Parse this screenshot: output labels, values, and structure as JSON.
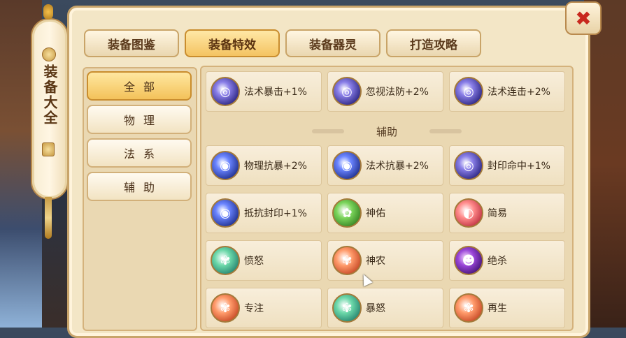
{
  "scroll": {
    "title": "装备大全"
  },
  "close": {
    "glyph": "✖"
  },
  "tabs": [
    {
      "label": "装备图鉴",
      "active": false
    },
    {
      "label": "装备特效",
      "active": true
    },
    {
      "label": "装备器灵",
      "active": false
    },
    {
      "label": "打造攻略",
      "active": false
    }
  ],
  "categories": [
    {
      "label": "全部",
      "active": true
    },
    {
      "label": "物理",
      "active": false
    },
    {
      "label": "法系",
      "active": false
    },
    {
      "label": "辅助",
      "active": false
    }
  ],
  "top_row": [
    {
      "label": "法术暴击+1%",
      "icon": "spell-crit-icon",
      "color": "violet"
    },
    {
      "label": "忽视法防+2%",
      "icon": "ignore-magic-def-icon",
      "color": "violet"
    },
    {
      "label": "法术连击+2%",
      "icon": "spell-combo-icon",
      "color": "violet"
    }
  ],
  "section": {
    "title": "辅助"
  },
  "grid": [
    {
      "label": "物理抗暴+2%",
      "icon": "physical-crit-resist-icon",
      "color": "blue"
    },
    {
      "label": "法术抗暴+2%",
      "icon": "spell-crit-resist-icon",
      "color": "blue"
    },
    {
      "label": "封印命中+1%",
      "icon": "seal-hit-icon",
      "color": "violet"
    },
    {
      "label": "抵抗封印+1%",
      "icon": "seal-resist-icon",
      "color": "blue"
    },
    {
      "label": "神佑",
      "icon": "divine-blessing-icon",
      "color": "green"
    },
    {
      "label": "简易",
      "icon": "simple-icon",
      "color": "red"
    },
    {
      "label": "愤怒",
      "icon": "anger-icon",
      "color": "teal"
    },
    {
      "label": "神农",
      "icon": "shennong-icon",
      "color": "orange"
    },
    {
      "label": "绝杀",
      "icon": "fatal-strike-icon",
      "color": "purple"
    },
    {
      "label": "专注",
      "icon": "focus-icon",
      "color": "orange"
    },
    {
      "label": "暴怒",
      "icon": "rage-icon",
      "color": "teal"
    },
    {
      "label": "再生",
      "icon": "regeneration-icon",
      "color": "orange"
    }
  ]
}
